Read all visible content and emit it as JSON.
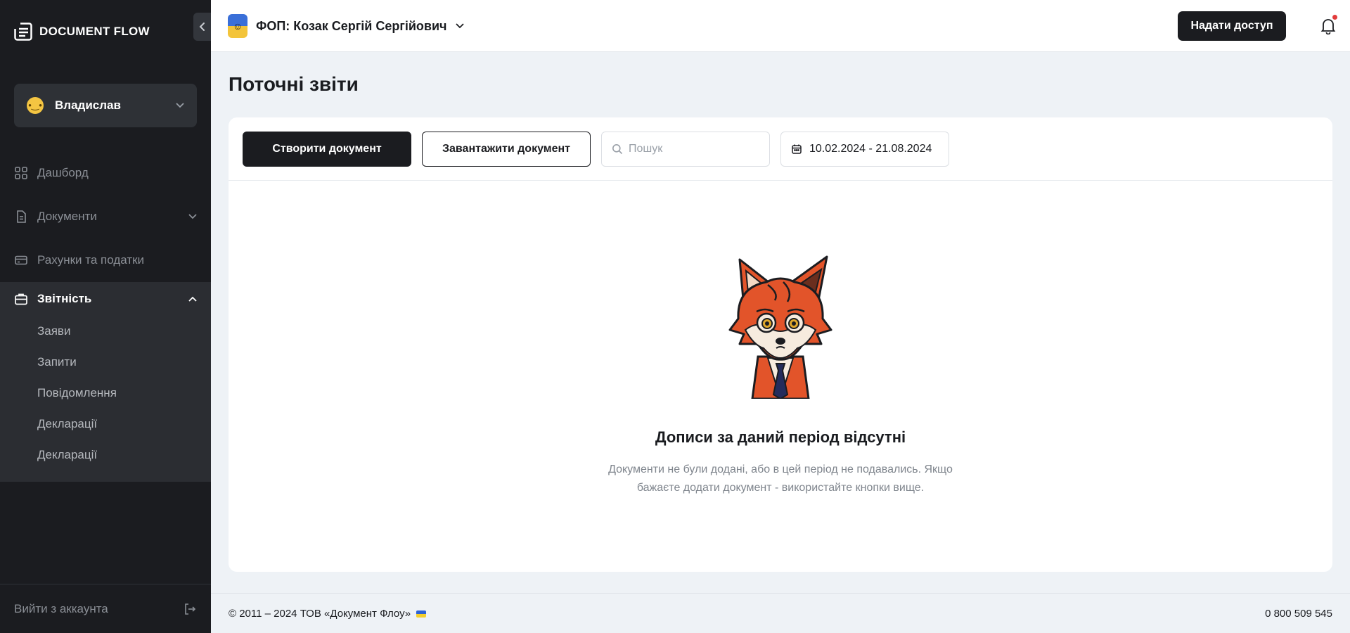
{
  "sidebar": {
    "logo_text": "DOCUMENT FLOW",
    "user_name": "Владислав",
    "nav": [
      {
        "label": "Дашборд"
      },
      {
        "label": "Документи"
      },
      {
        "label": "Рахунки та податки"
      },
      {
        "label": "Звітність"
      }
    ],
    "submenu": [
      {
        "label": "Заяви"
      },
      {
        "label": "Запити"
      },
      {
        "label": "Повідомлення"
      },
      {
        "label": "Декларації"
      },
      {
        "label": "Декларації"
      }
    ],
    "logout_label": "Вийти з аккаунта"
  },
  "header": {
    "org_title": "ФОП: Козак Сергій Сергійович",
    "access_button": "Надати доступ"
  },
  "main": {
    "page_title": "Поточні звіти",
    "create_button": "Створити документ",
    "upload_button": "Завантажити документ",
    "search_placeholder": "Пошук",
    "date_range": "10.02.2024 - 21.08.2024",
    "empty_title": "Дописи за даний період відсутні",
    "empty_text": "Документи не були додані, або в цей період не подавались. Якщо бажаєте додати документ - використайте кнопки вище."
  },
  "footer": {
    "copyright": "© 2011 – 2024 ТОВ «Документ Флоу»",
    "phone": "0 800 509 545"
  },
  "colors": {
    "sidebar_bg": "#1b1c20",
    "accent": "#1b1c20",
    "page_bg": "#eef2f6",
    "notification_dot": "#e23b3b"
  }
}
